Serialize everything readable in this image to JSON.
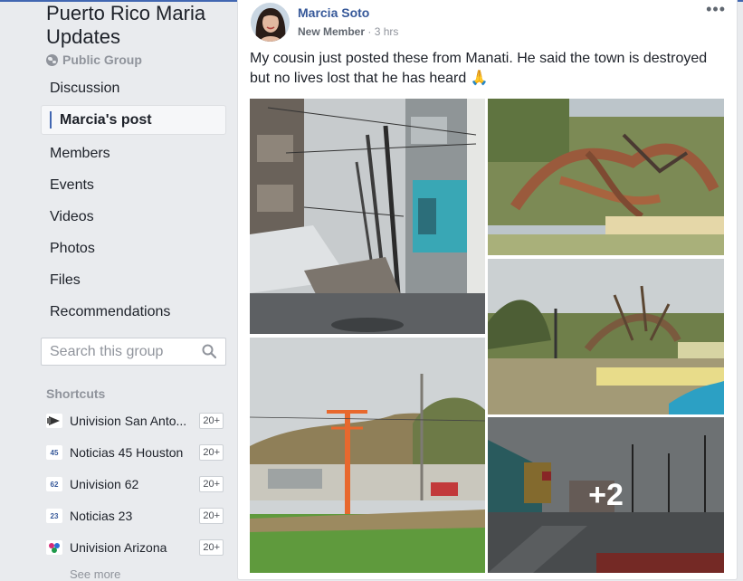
{
  "group": {
    "title": "Puerto Rico Maria Updates",
    "type": "Public Group"
  },
  "nav": {
    "items": [
      "Discussion",
      "Marcia's post",
      "Members",
      "Events",
      "Videos",
      "Photos",
      "Files",
      "Recommendations"
    ],
    "active": "Marcia's post"
  },
  "search": {
    "placeholder": "Search this group"
  },
  "shortcuts": {
    "heading": "Shortcuts",
    "items": [
      {
        "label": "Univision San Anto...",
        "badge": "20+",
        "thumb": ""
      },
      {
        "label": "Noticias 45 Houston",
        "badge": "20+",
        "thumb": "45"
      },
      {
        "label": "Univision 62",
        "badge": "20+",
        "thumb": "62"
      },
      {
        "label": "Noticias 23",
        "badge": "20+",
        "thumb": "23"
      },
      {
        "label": "Univision Arizona",
        "badge": "20+",
        "thumb": ""
      }
    ],
    "see_more": "See more"
  },
  "post": {
    "author": "Marcia Soto",
    "role": "New Member",
    "separator": " · ",
    "time": "3 hrs",
    "more": "•••",
    "text": "My cousin just posted these from Manati. He said the town is destroyed but no lives lost that he has heard 🙏",
    "photos": [
      {
        "name": "flooded-street-with-downed-power-lines"
      },
      {
        "name": "uprooted-tree-on-wall"
      },
      {
        "name": "fallen-tree-in-park"
      },
      {
        "name": "bent-orange-utility-pole"
      },
      {
        "name": "rainy-street-view",
        "overlay": "+2"
      }
    ]
  },
  "colors": {
    "accent": "#4267b2",
    "link": "#365899",
    "background": "#e9ebee",
    "muted": "#90949c"
  }
}
